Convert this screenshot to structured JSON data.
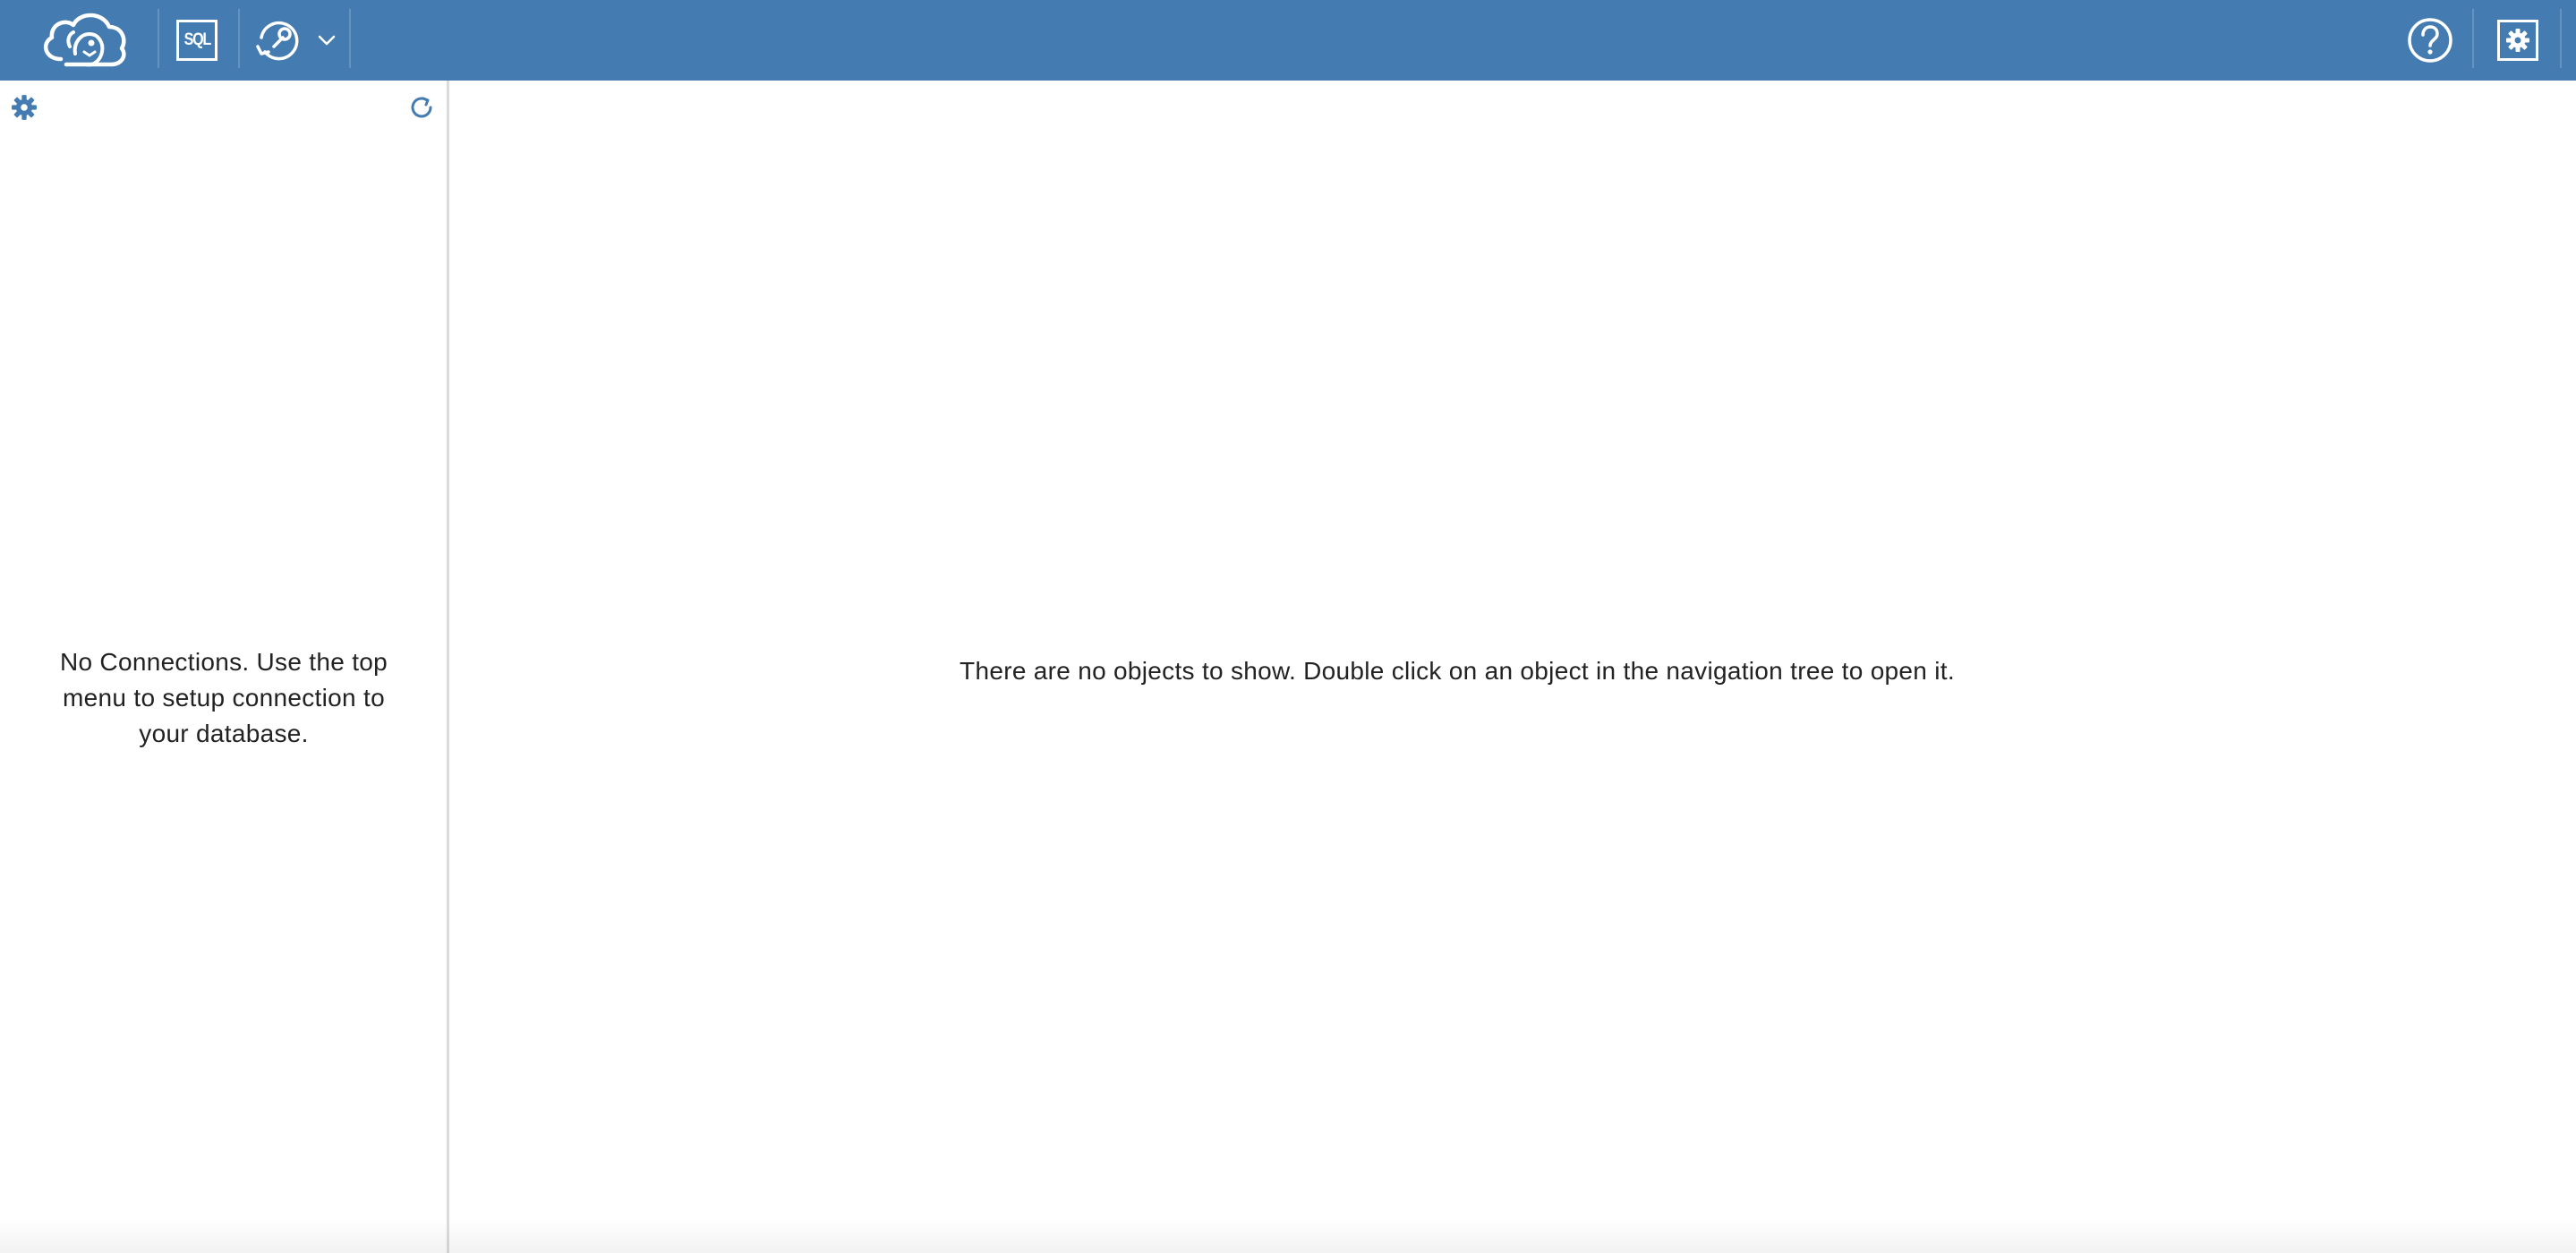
{
  "app": {
    "brand_color": "#447cb1",
    "logo_icon": "cloudbeaver-logo-icon"
  },
  "toolbar": {
    "sql_editor_label": "SQL",
    "sql_editor_icon": "sql-editor-icon",
    "connect_icon": "connect-icon",
    "connect_dropdown_icon": "chevron-down-icon",
    "help_icon": "help-icon",
    "settings_icon": "settings-icon"
  },
  "navigator": {
    "settings_icon": "gear-icon",
    "refresh_icon": "refresh-icon",
    "empty_message": "No Connections. Use the top menu to setup connection to your database."
  },
  "main": {
    "empty_message": "There are no objects to show. Double click on an object in the navigation tree to open it."
  }
}
